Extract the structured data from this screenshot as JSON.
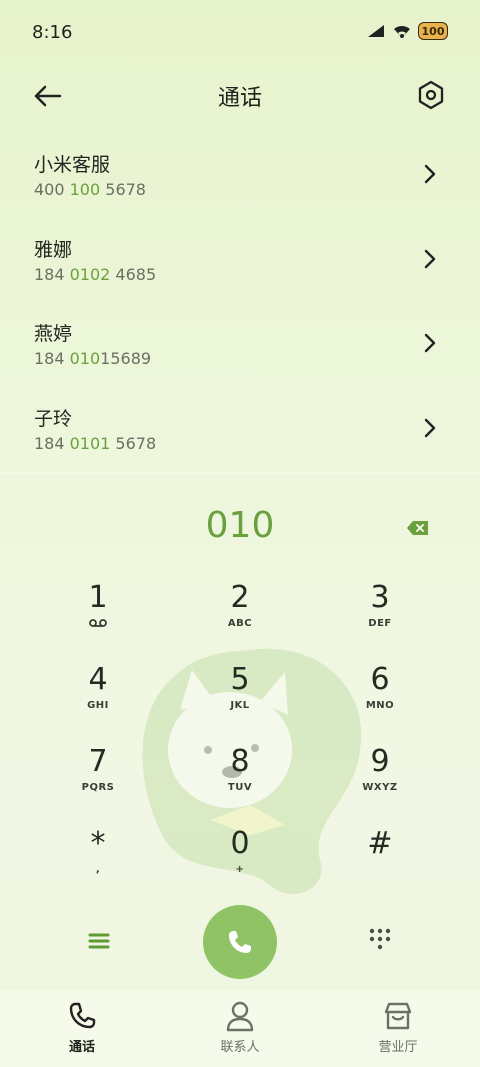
{
  "status_bar": {
    "time": "8:16",
    "battery": "100"
  },
  "header": {
    "title": "通话"
  },
  "contacts": [
    {
      "name": "小米客服",
      "phone_pre": "400 ",
      "phone_hl": "100",
      "phone_post": " 5678"
    },
    {
      "name": "雅娜",
      "phone_pre": "184 ",
      "phone_hl": "0102",
      "phone_post": " 4685"
    },
    {
      "name": "燕婷",
      "phone_pre": "184 ",
      "phone_hl": "010",
      "phone_post": "15689"
    },
    {
      "name": "子玲",
      "phone_pre": "184 ",
      "phone_hl": "0101",
      "phone_post": " 5678"
    }
  ],
  "dialer": {
    "number": "010"
  },
  "keypad": [
    {
      "digit": "1",
      "sub": ""
    },
    {
      "digit": "2",
      "sub": "ABC"
    },
    {
      "digit": "3",
      "sub": "DEF"
    },
    {
      "digit": "4",
      "sub": "GHI"
    },
    {
      "digit": "5",
      "sub": "JKL"
    },
    {
      "digit": "6",
      "sub": "MNO"
    },
    {
      "digit": "7",
      "sub": "PQRS"
    },
    {
      "digit": "8",
      "sub": "TUV"
    },
    {
      "digit": "9",
      "sub": "WXYZ"
    },
    {
      "digit": "*",
      "sub": ","
    },
    {
      "digit": "0",
      "sub": "+"
    },
    {
      "digit": "#",
      "sub": ""
    }
  ],
  "tabs": [
    {
      "label": "通话",
      "icon": "phone-icon",
      "active": true
    },
    {
      "label": "联系人",
      "icon": "person-icon",
      "active": false
    },
    {
      "label": "营业厅",
      "icon": "store-icon",
      "active": false
    }
  ],
  "colors": {
    "accent": "#6aa03e",
    "call_button": "#8fc365"
  }
}
